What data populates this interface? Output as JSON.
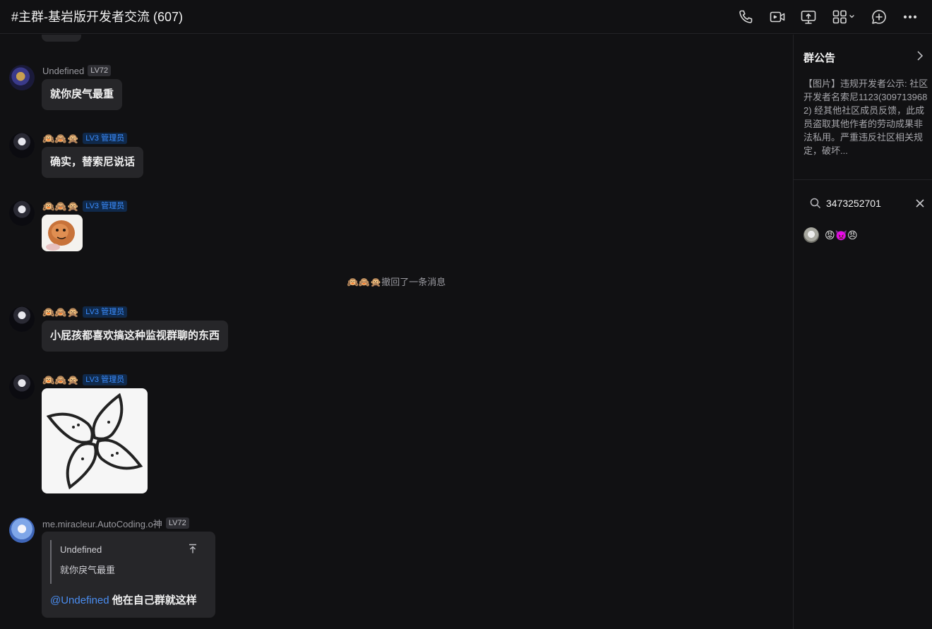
{
  "header": {
    "title": "#主群-基岩版开发者交流 (607)",
    "icons": [
      "phone-icon",
      "video-icon",
      "screen-share-icon",
      "apps-icon",
      "add-icon",
      "more-icon"
    ]
  },
  "messages": [
    {
      "sender": "Undefined",
      "level": "LV72",
      "text": "就你戾气最重"
    },
    {
      "sender": "🙉🙈🙊",
      "badge": "LV3 管理员",
      "text": "确实，替索尼说话"
    },
    {
      "sender": "🙉🙈🙊",
      "badge": "LV3 管理员"
    },
    {
      "sender": "🙉🙈🙊",
      "badge": "LV3 管理员",
      "text": "小屁孩都喜欢搞这种监视群聊的东西"
    },
    {
      "sender": "🙉🙈🙊",
      "badge": "LV3 管理员"
    },
    {
      "sender": "me.miracleur.AutoCoding.o神",
      "level": "LV72",
      "quote": {
        "name": "Undefined",
        "text": "就你戾气最重"
      },
      "mention": "@Undefined",
      "text": " 他在自己群就这样"
    }
  ],
  "system_notice": {
    "sender": "🙉🙈🙊",
    "text": "撤回了一条消息"
  },
  "sidebar": {
    "announcement_title": "群公告",
    "announcement_body": "【图片】违规开发者公示: 社区开发者名索尼1123(3097139682) 经其他社区成员反馈，此成员盗取其他作者的劳动成果非法私用。严重违反社区相关规定，破坏...",
    "search_value": "3473252701",
    "search_result_name": "😡👿😠"
  }
}
